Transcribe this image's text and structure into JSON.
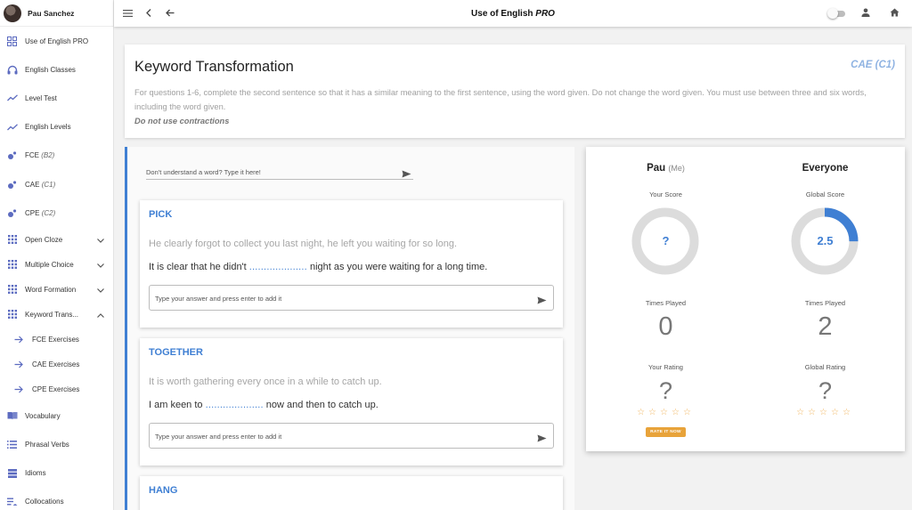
{
  "user": {
    "name": "Pau Sanchez"
  },
  "sidebar": {
    "items": [
      {
        "label": "Use of English PRO",
        "icon": "grid-icon"
      },
      {
        "label": "English Classes",
        "icon": "headphones-icon"
      },
      {
        "label": "Level Test",
        "icon": "trending-icon"
      },
      {
        "label": "English Levels",
        "icon": "trending-icon"
      },
      {
        "label": "FCE",
        "suffix": "(B2)",
        "icon": "dots-icon"
      },
      {
        "label": "CAE",
        "suffix": "(C1)",
        "icon": "dots-icon"
      },
      {
        "label": "CPE",
        "suffix": "(C2)",
        "icon": "dots-icon"
      },
      {
        "label": "Open Cloze",
        "icon": "apps-icon",
        "chevron": "down"
      },
      {
        "label": "Multiple Choice",
        "icon": "apps-icon",
        "chevron": "down"
      },
      {
        "label": "Word Formation",
        "icon": "apps-icon",
        "chevron": "down"
      },
      {
        "label": "Keyword Trans...",
        "icon": "apps-icon",
        "chevron": "up"
      },
      {
        "label": "FCE Exercises",
        "icon": "arrow-right-icon",
        "sub": true
      },
      {
        "label": "CAE Exercises",
        "icon": "arrow-right-icon",
        "sub": true
      },
      {
        "label": "CPE Exercises",
        "icon": "arrow-right-icon",
        "sub": true
      },
      {
        "label": "Vocabulary",
        "icon": "book-icon"
      },
      {
        "label": "Phrasal Verbs",
        "icon": "list-icon"
      },
      {
        "label": "Idioms",
        "icon": "stack-icon"
      },
      {
        "label": "Collocations",
        "icon": "playlist-icon"
      }
    ]
  },
  "topbar": {
    "title": "Use of English",
    "title_suffix": "PRO"
  },
  "header": {
    "title": "Keyword Transformation",
    "level": "CAE (C1)",
    "instructions": "For questions 1-6, complete the second sentence so that it has a similar meaning to the first sentence, using the word given. Do not change the word given. You must use between three and six words, including the word given.",
    "note": "Do not use contractions"
  },
  "lookup": {
    "placeholder": "Don't understand a word? Type it here!"
  },
  "questions": [
    {
      "word": "PICK",
      "sentence1": "He clearly forgot to collect you last night, he left you waiting for so long.",
      "s2_before": "It is clear that he didn't",
      "s2_gap": "....................",
      "s2_after": "night as you were waiting for a long time.",
      "answer_placeholder": "Type your answer and press enter to add it"
    },
    {
      "word": "TOGETHER",
      "sentence1": "It is worth gathering every once in a while to catch up.",
      "s2_before": "I am keen to",
      "s2_gap": "....................",
      "s2_after": "now and then to catch up.",
      "answer_placeholder": "Type your answer and press enter to add it"
    },
    {
      "word": "HANG"
    }
  ],
  "stats": {
    "me": {
      "name": "Pau",
      "tag": "(Me)",
      "score_label": "Your Score",
      "score": "?",
      "score_fraction": 0,
      "times_label": "Times Played",
      "times": "0",
      "rating_label": "Your Rating",
      "rating": "?",
      "stars": "☆☆☆☆☆",
      "rate_button": "RATE IT NOW"
    },
    "everyone": {
      "name": "Everyone",
      "score_label": "Global Score",
      "score": "2.5",
      "score_fraction": 0.25,
      "times_label": "Times Played",
      "times": "2",
      "rating_label": "Global Rating",
      "rating": "?",
      "stars": "☆☆☆☆☆"
    }
  },
  "colors": {
    "accent": "#3f7fd3",
    "donut_track": "#dcdcdc",
    "star": "#f0b35a",
    "rate_button": "#e8a33a"
  }
}
